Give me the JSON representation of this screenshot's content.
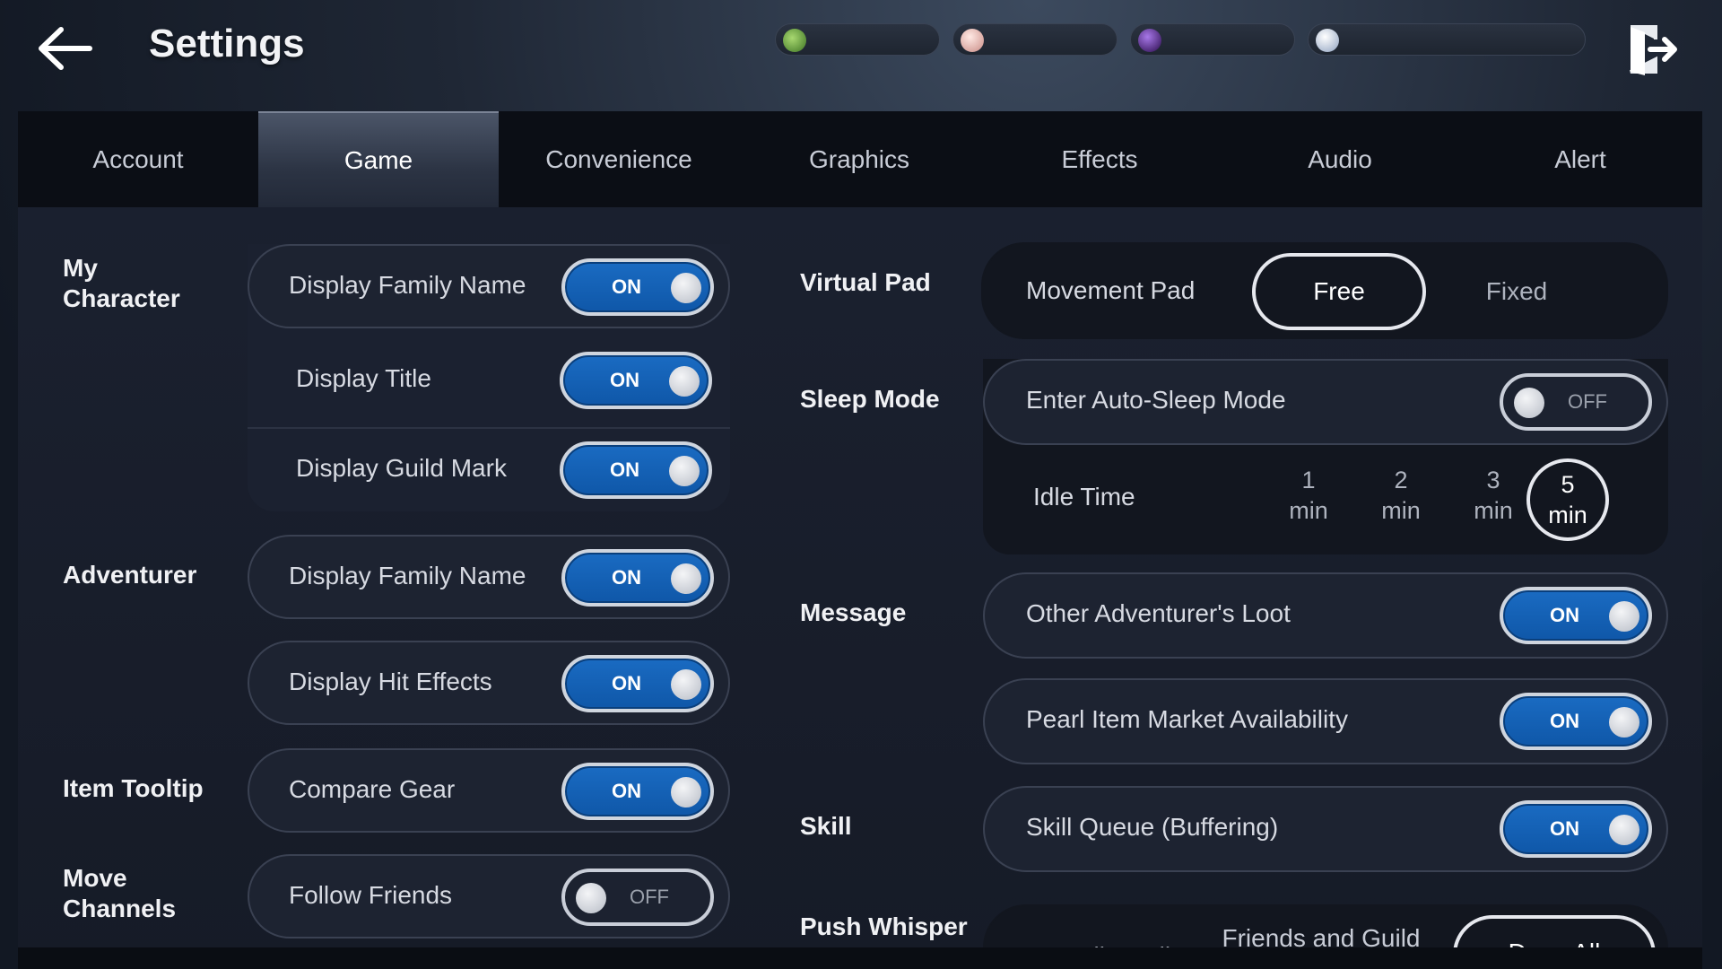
{
  "header": {
    "title": "Settings",
    "currencies": [
      {
        "icon": "green-gem-icon",
        "color": "#5a9a3a"
      },
      {
        "icon": "pink-pearl-icon",
        "color": "#e8b6b0"
      },
      {
        "icon": "purple-orb-icon",
        "color": "#4a1a78"
      },
      {
        "icon": "silver-coin-icon",
        "color": "#c6d2e4"
      }
    ]
  },
  "tabs": [
    "Account",
    "Game",
    "Convenience",
    "Graphics",
    "Effects",
    "Audio",
    "Alert"
  ],
  "active_tab": "Game",
  "left": {
    "my_character": {
      "label": "My\nCharacter",
      "rows": [
        {
          "label": "Display Family Name",
          "state": "ON"
        },
        {
          "label": "Display Title",
          "state": "ON"
        },
        {
          "label": "Display Guild Mark",
          "state": "ON"
        }
      ]
    },
    "adventurer": {
      "label": "Adventurer",
      "rows": [
        {
          "label": "Display Family Name",
          "state": "ON"
        },
        {
          "label": "Display Hit Effects",
          "state": "ON"
        }
      ]
    },
    "item_tooltip": {
      "label": "Item Tooltip",
      "rows": [
        {
          "label": "Compare Gear",
          "state": "ON"
        }
      ]
    },
    "move_channels": {
      "label": "Move\nChannels",
      "rows": [
        {
          "label": "Follow Friends",
          "state": "OFF"
        }
      ]
    }
  },
  "right": {
    "virtual_pad": {
      "label": "Virtual Pad",
      "row_label": "Movement Pad",
      "options": [
        "Free",
        "Fixed"
      ],
      "selected": "Free"
    },
    "sleep_mode": {
      "label": "Sleep Mode",
      "row_label": "Enter Auto-Sleep Mode",
      "state": "OFF",
      "idle_label": "Idle Time",
      "idle_options": [
        {
          "num": "1",
          "unit": "min"
        },
        {
          "num": "2",
          "unit": "min"
        },
        {
          "num": "3",
          "unit": "min"
        },
        {
          "num": "5",
          "unit": "min"
        }
      ],
      "idle_selected": "5"
    },
    "message": {
      "label": "Message",
      "rows": [
        {
          "label": "Other Adventurer's Loot",
          "state": "ON"
        },
        {
          "label": "Pearl Item Market Availability",
          "state": "ON"
        }
      ]
    },
    "skill": {
      "label": "Skill",
      "rows": [
        {
          "label": "Skill Queue (Buffering)",
          "state": "ON"
        }
      ]
    },
    "push_whisper": {
      "label": "Push Whisper",
      "options": [
        "Allow All",
        "Friends and Guild",
        "Deny All"
      ],
      "selected": "Deny All"
    }
  }
}
